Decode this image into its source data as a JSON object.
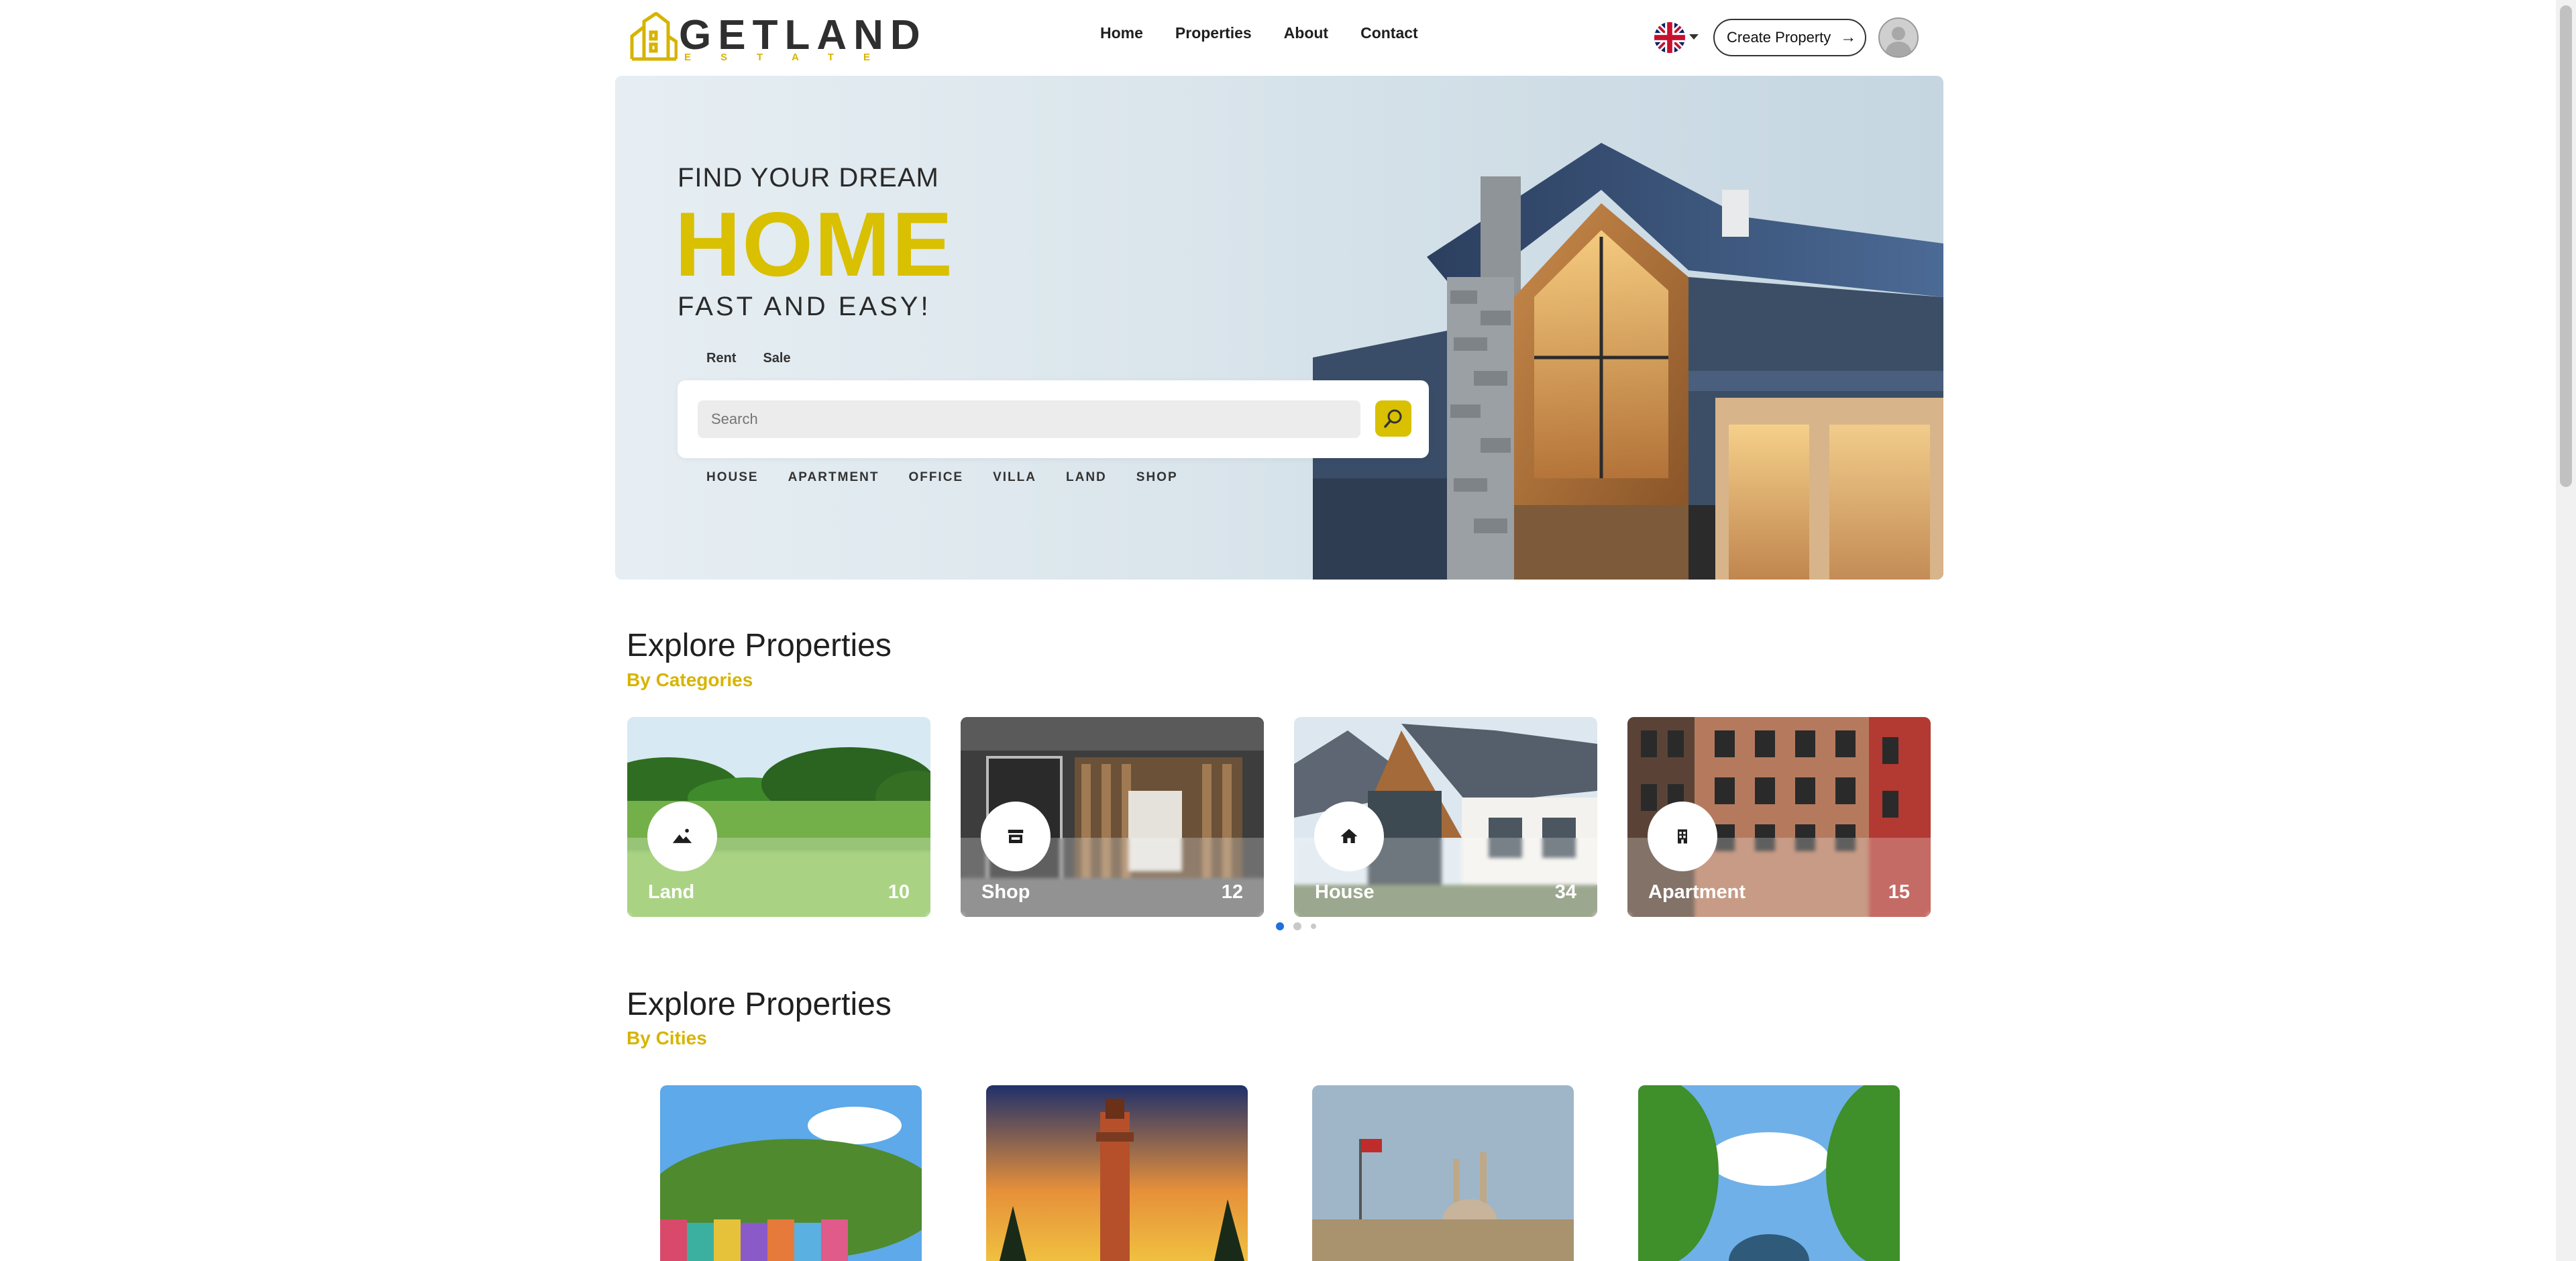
{
  "brand": {
    "name": "GETLAND",
    "sub": "ESTATE",
    "accent": "#d9c000"
  },
  "nav": {
    "items": [
      "Home",
      "Properties",
      "About",
      "Contact"
    ]
  },
  "header": {
    "create_label": "Create Property",
    "language_icon": "uk-flag-icon"
  },
  "hero": {
    "line1": "FIND YOUR DREAM",
    "line2": "HOME",
    "line3": "FAST AND EASY!",
    "tabs": [
      "Rent",
      "Sale"
    ],
    "search_placeholder": "Search",
    "categories": [
      "HOUSE",
      "APARTMENT",
      "OFFICE",
      "VILLA",
      "LAND",
      "SHOP"
    ]
  },
  "section_categories": {
    "title": "Explore Properties",
    "subtitle": "By Categories"
  },
  "category_cards": [
    {
      "name": "Land",
      "count": "10",
      "icon": "landscape-icon"
    },
    {
      "name": "Shop",
      "count": "12",
      "icon": "store-icon"
    },
    {
      "name": "House",
      "count": "34",
      "icon": "home-icon"
    },
    {
      "name": "Apartment",
      "count": "15",
      "icon": "building-icon"
    }
  ],
  "carousel": {
    "pages": 3,
    "active": 1
  },
  "section_cities": {
    "title": "Explore Properties",
    "subtitle": "By Cities"
  }
}
